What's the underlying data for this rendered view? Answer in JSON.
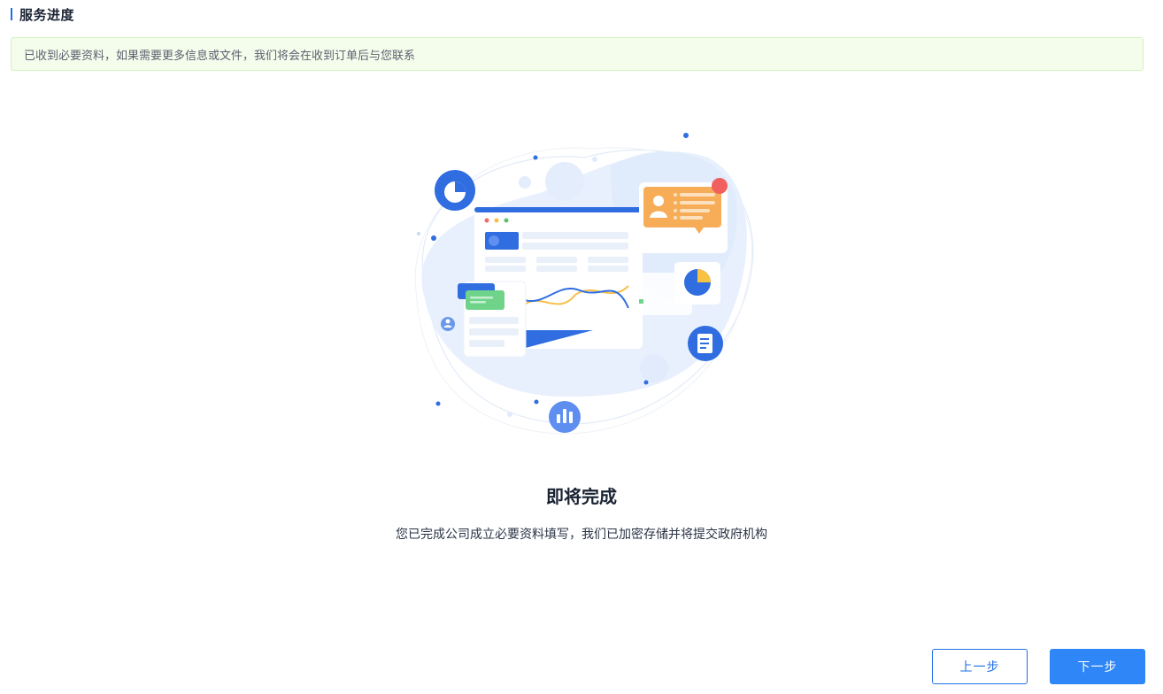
{
  "header": {
    "title": "服务进度"
  },
  "notice": {
    "text": "已收到必要资料，如果需要更多信息或文件，我们将会在收到订单后与您联系"
  },
  "result": {
    "heading": "即将完成",
    "description": "您已完成公司成立必要资料填写，我们已加密存储并将提交政府机构"
  },
  "actions": {
    "prev_label": "上一步",
    "next_label": "下一步"
  },
  "colors": {
    "accent": "#1f6fe5",
    "primary_button": "#2f86f6",
    "notice_bg": "#f4fdec",
    "notice_border": "#d3f2bd"
  }
}
